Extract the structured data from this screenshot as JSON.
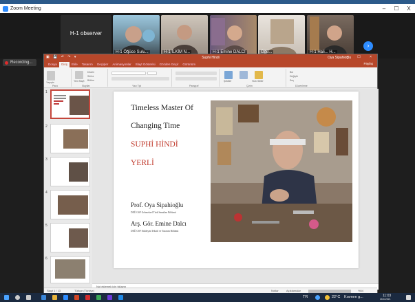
{
  "window": {
    "title": "Zoom Meeting",
    "minimize": "–",
    "maximize": "☐",
    "close": "X"
  },
  "gallery": {
    "observer_label": "H-1 observer",
    "participants": [
      {
        "name": "H-1 Öğüce Sulu..."
      },
      {
        "name": "H-1 İLKİM N..."
      },
      {
        "name": "H-1 Emine DALCI"
      },
      {
        "name": "Öğü..."
      },
      {
        "name": "H-1 Hali... H..."
      }
    ],
    "next_icon": "chevron-right-icon"
  },
  "recording": {
    "label": "Recording..."
  },
  "ppt": {
    "qat": "▣ 💾 ↶ ↷ ▾",
    "doc_title": "Suphi Hindi",
    "user": "Oya Sipahioğlu",
    "share": "Paylaş",
    "tabs": [
      "Dosya",
      "Giriş",
      "Ekle",
      "Tasarım",
      "Geçişler",
      "Animasyonlar",
      "Slayt Gösterisi",
      "Gözden Geçir",
      "Görünüm"
    ],
    "active_tab": "Giriş",
    "ribbon_groups": [
      "Pano",
      "Slaytlar",
      "Yazı Tipi",
      "Paragraf",
      "Çizim",
      "Düzenleme"
    ],
    "ribbon_buttons": [
      "Yapıştır",
      "Yeni Slayt",
      "Düzen",
      "Sıfırla",
      "Bölüm",
      "Şekiller",
      "Hızlı Stiller",
      "Bul",
      "Değiştir",
      "Seç"
    ],
    "slide": {
      "line1": "Timeless Master Of",
      "line2": "Changing Time",
      "line3": "SUPHİ HİNDİ",
      "line4": "YERLİ",
      "author1": "Prof. Oya Sipahioğlu",
      "author1_aff": "DEÜ GSF Geleneksel Türk Sanatları Bölümü",
      "author2": "Arş. Gör. Emine Dalcı",
      "author2_aff": "DEÜ GSF Etkileşim Tekstil ve Tasarım Bölümü"
    },
    "thumb_numbers": [
      "1",
      "2",
      "3",
      "4",
      "5",
      "6"
    ],
    "notes_placeholder": "Not eklemek için tıklayın",
    "status_left": "Slayt 1 / 13",
    "status_lang": "Türkçe (Türkiye)",
    "status_notes": "Notlar",
    "status_comments": "Açıklamalar",
    "zoom": "%54"
  },
  "taskbar": {
    "temp": "22°C",
    "weather": "Kısmen g...",
    "time": "11:03",
    "date": "26.6.2021",
    "lang": "TR"
  }
}
